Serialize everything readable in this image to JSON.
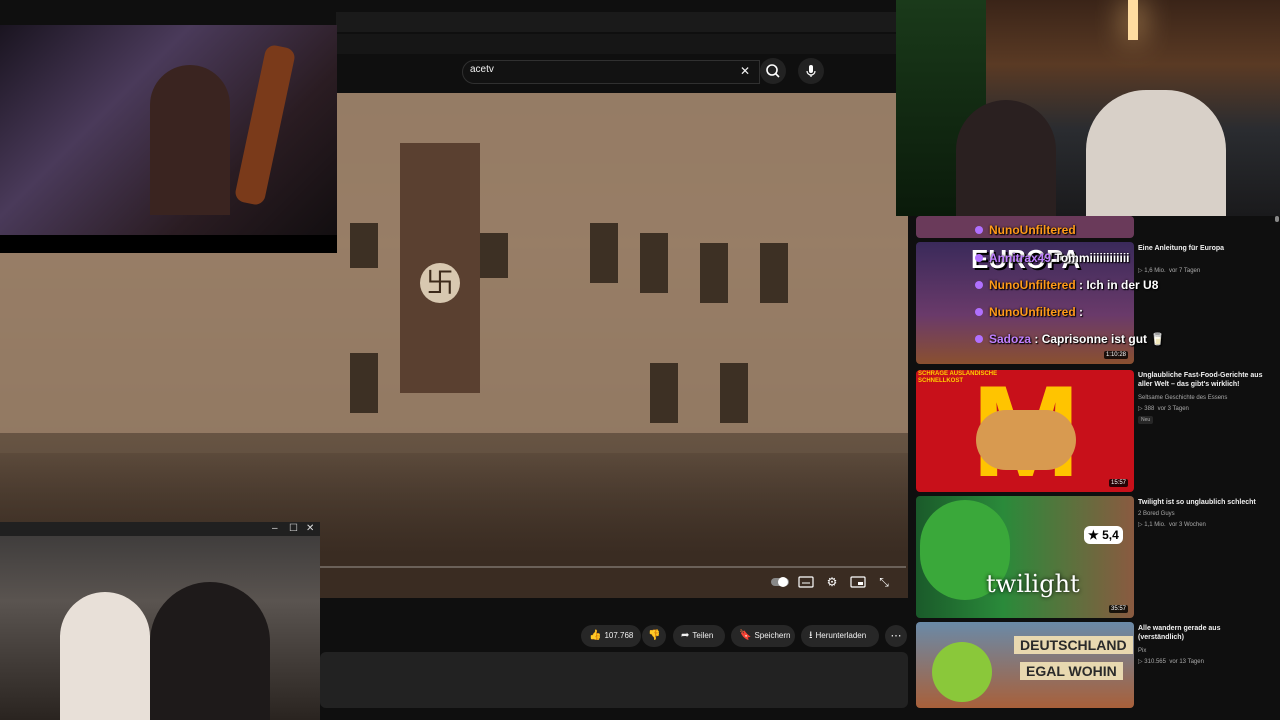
{
  "search": {
    "value": "acetv",
    "clear_icon": "close-icon",
    "search_icon": "search-icon",
    "mic_icon": "mic-icon"
  },
  "player": {
    "controls": [
      "autoplay-toggle-icon",
      "subtitles-icon",
      "settings-icon",
      "miniplayer-icon",
      "fullscreen-icon"
    ]
  },
  "actions": {
    "like_count": "107.768",
    "share_label": "Teilen",
    "save_label": "Speichern",
    "download_label": "Herunterladen",
    "more_icon": "more-icon"
  },
  "sidebar": {
    "videos": [
      {
        "title": "Eine Anleitung für Europa",
        "channel": "",
        "views": "1,6 Mio.",
        "age": "vor 7 Tagen",
        "duration": "1:10:28",
        "badge": ""
      },
      {
        "title": "Unglaubliche Fast-Food-Gerichte aus aller Welt – das gibt's wirklich!",
        "channel": "Seltsame Geschichte des Essens",
        "views": "388",
        "age": "vor 3 Tagen",
        "duration": "15:57",
        "badge": "Neu"
      },
      {
        "title": "Twilight ist so unglaublich schlecht",
        "channel": "2 Bored Guys",
        "views": "1,1 Mio.",
        "age": "vor 3 Wochen",
        "duration": "35:57",
        "badge": ""
      },
      {
        "title": "Alle wandern gerade aus (verständlich)",
        "channel": "Pix",
        "views": "310.565",
        "age": "vor 13 Tagen",
        "duration": "",
        "badge": ""
      }
    ],
    "thumb_texts": {
      "t1": "EUROPA",
      "t2": "SCHRÄGE AUSLÄNDISCHE SCHNELLKOST",
      "t3_rating": "5,4",
      "t3_title": "twilight",
      "t4_sign1": "DEUTSCHLAND",
      "t4_sign2": "EGAL WOHIN"
    }
  },
  "chat": [
    {
      "user": "NunoUnfiltered",
      "text": ""
    },
    {
      "user": "Annitrax49",
      "text": "Tommiiiiiiiiiiii"
    },
    {
      "user": "NunoUnfiltered",
      "text": "Ich in der U8"
    },
    {
      "user": "NunoUnfiltered",
      "text": ""
    },
    {
      "user": "Sadoza",
      "text": "Caprisonne ist gut 🥛"
    }
  ],
  "colors": {
    "background": "#0f0f0f",
    "pill": "#272727",
    "chat_user": "#ff9a1a"
  }
}
